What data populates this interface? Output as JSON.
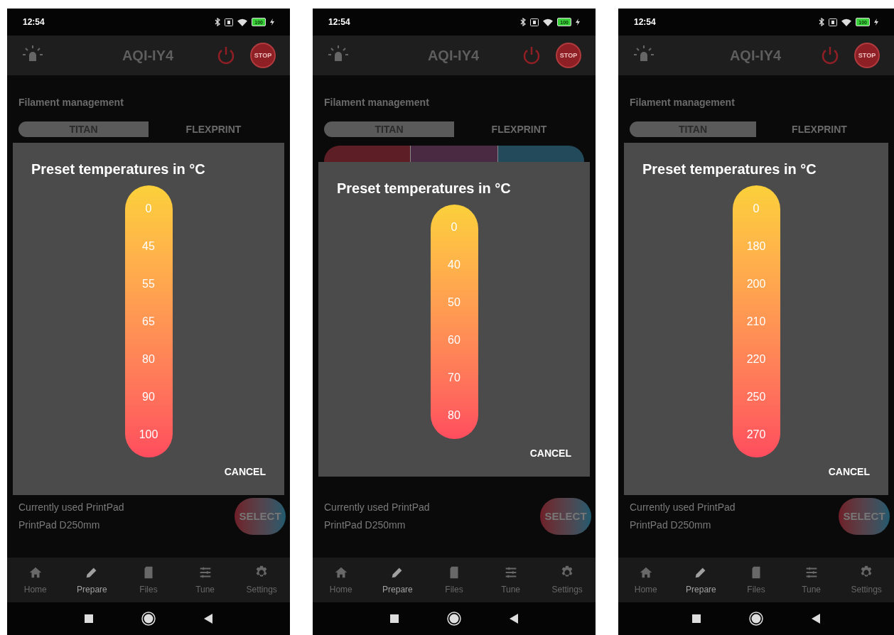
{
  "phones": [
    {
      "status_bar": {
        "time": "12:54",
        "battery": "100"
      },
      "app_bar": {
        "title": "AQI-IY4",
        "stop_label": "STOP"
      },
      "section_title": "Filament management",
      "tabs": [
        {
          "label": "TITAN",
          "selected": true
        },
        {
          "label": "FLEXPRINT",
          "selected": false
        }
      ],
      "dialog": {
        "title": "Preset temperatures in °C",
        "presets": [
          "0",
          "45",
          "55",
          "65",
          "80",
          "90",
          "100"
        ],
        "cancel": "CANCEL"
      },
      "printpad": {
        "label": "Currently used PrintPad",
        "value": "PrintPad D250mm",
        "button": "SELECT"
      },
      "bottom_nav": [
        {
          "label": "Home",
          "selected": false
        },
        {
          "label": "Prepare",
          "selected": true
        },
        {
          "label": "Files",
          "selected": false
        },
        {
          "label": "Tune",
          "selected": false
        },
        {
          "label": "Settings",
          "selected": false
        }
      ]
    },
    {
      "status_bar": {
        "time": "12:54",
        "battery": "100"
      },
      "app_bar": {
        "title": "AQI-IY4",
        "stop_label": "STOP"
      },
      "section_title": "Filament management",
      "tabs": [
        {
          "label": "TITAN",
          "selected": true
        },
        {
          "label": "FLEXPRINT",
          "selected": false
        }
      ],
      "dialog": {
        "title": "Preset temperatures in °C",
        "presets": [
          "0",
          "40",
          "50",
          "60",
          "70",
          "80"
        ],
        "cancel": "CANCEL"
      },
      "printpad": {
        "label": "Currently used PrintPad",
        "value": "PrintPad D250mm",
        "button": "SELECT"
      },
      "bottom_nav": [
        {
          "label": "Home",
          "selected": false
        },
        {
          "label": "Prepare",
          "selected": true
        },
        {
          "label": "Files",
          "selected": false
        },
        {
          "label": "Tune",
          "selected": false
        },
        {
          "label": "Settings",
          "selected": false
        }
      ]
    },
    {
      "status_bar": {
        "time": "12:54",
        "battery": "100"
      },
      "app_bar": {
        "title": "AQI-IY4",
        "stop_label": "STOP"
      },
      "section_title": "Filament management",
      "tabs": [
        {
          "label": "TITAN",
          "selected": true
        },
        {
          "label": "FLEXPRINT",
          "selected": false
        }
      ],
      "dialog": {
        "title": "Preset temperatures in °C",
        "presets": [
          "0",
          "180",
          "200",
          "210",
          "220",
          "250",
          "270"
        ],
        "cancel": "CANCEL"
      },
      "printpad": {
        "label": "Currently used PrintPad",
        "value": "PrintPad D250mm",
        "button": "SELECT"
      },
      "bottom_nav": [
        {
          "label": "Home",
          "selected": false
        },
        {
          "label": "Prepare",
          "selected": true
        },
        {
          "label": "Files",
          "selected": false
        },
        {
          "label": "Tune",
          "selected": false
        },
        {
          "label": "Settings",
          "selected": false
        }
      ]
    }
  ]
}
